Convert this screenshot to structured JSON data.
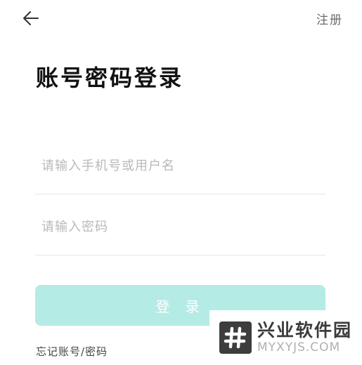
{
  "header": {
    "back_icon": "arrow-left-icon",
    "register_label": "注册"
  },
  "title": "账号密码登录",
  "form": {
    "account_placeholder": "请输入手机号或用户名",
    "account_value": "",
    "password_placeholder": "请输入密码",
    "password_value": ""
  },
  "login_label": "登 录",
  "forgot_label": "忘记账号/密码",
  "watermark": {
    "brand_cn": "兴业软件园",
    "brand_en": "MYXYJS.COM"
  },
  "colors": {
    "button_bg": "#b5ebe5",
    "button_text": "#ffffff",
    "placeholder": "#b9b9b9",
    "divider": "#e6e6e6"
  }
}
